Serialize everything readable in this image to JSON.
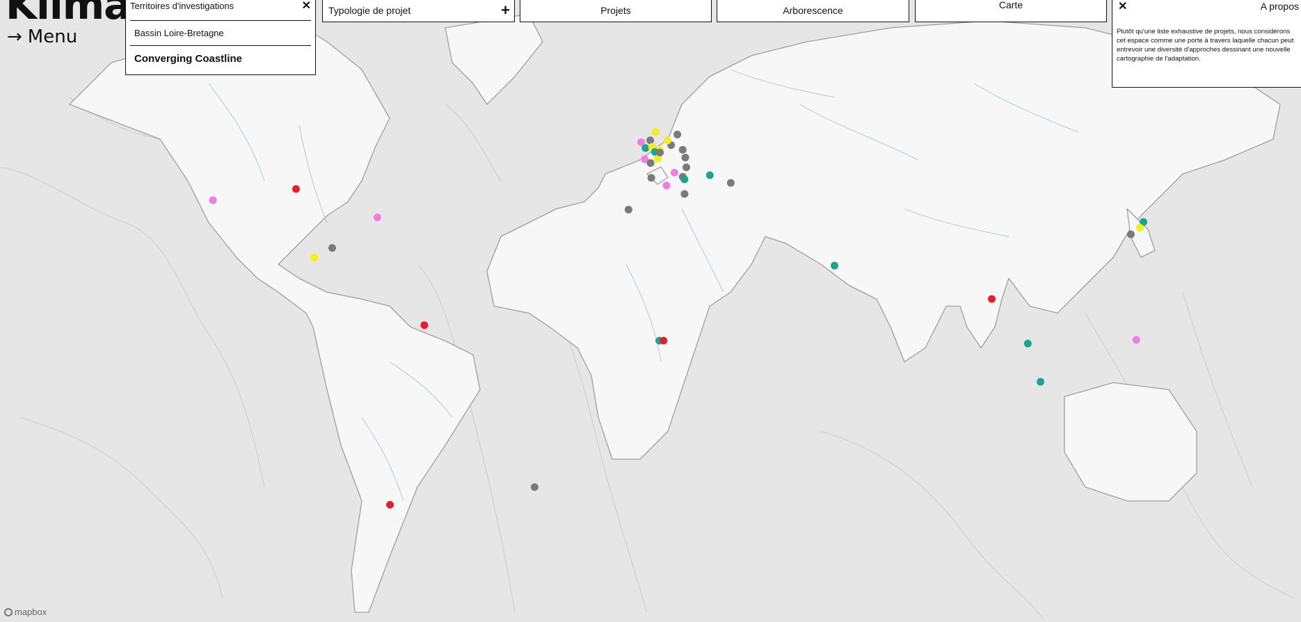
{
  "brand": "Klima",
  "menu": {
    "arrow": "→",
    "label": "Menu"
  },
  "territories": {
    "title": "Territoires d'investigations",
    "close": "✕",
    "items": [
      "Bassin Loire-Bretagne",
      "Converging Coastline"
    ]
  },
  "tabs": {
    "typologie": "Typologie de projet",
    "plus": "+",
    "projets": "Projets",
    "arborescence": "Arborescence",
    "carte": "Carte"
  },
  "apropos": {
    "close": "✕",
    "title": "A propos",
    "text": "Plutôt qu'une liste exhaustive de projets, nous considérons cet espace comme une porte à travers laquelle chacun peut entrevoir une diversité d'approches dessinant une nouvelle cartographie de l'adaptation."
  },
  "attribution": "mapbox",
  "colors": {
    "grey": "#7a7a7a",
    "red": "#e0202a",
    "teal": "#1fa28f",
    "yellow": "#f5ee1b",
    "pink": "#f27ce6",
    "background": "#e9e9e9",
    "land": "#f7f7f7"
  },
  "map_points": [
    {
      "lon": -120.5,
      "lat": 40.5,
      "color": "pink"
    },
    {
      "lon": -97.5,
      "lat": 42.8,
      "color": "red"
    },
    {
      "lon": -75.0,
      "lat": 36.8,
      "color": "pink"
    },
    {
      "lon": -92.5,
      "lat": 27.5,
      "color": "yellow"
    },
    {
      "lon": -87.5,
      "lat": 29.8,
      "color": "grey"
    },
    {
      "lon": -62.0,
      "lat": 10.0,
      "color": "red"
    },
    {
      "lon": -71.5,
      "lat": -36.5,
      "color": "red"
    },
    {
      "lon": -31.5,
      "lat": -32.5,
      "color": "grey"
    },
    {
      "lon": 2.0,
      "lat": 53.2,
      "color": "yellow"
    },
    {
      "lon": -2.0,
      "lat": 51.5,
      "color": "pink"
    },
    {
      "lon": -0.8,
      "lat": 50.5,
      "color": "teal"
    },
    {
      "lon": 0.5,
      "lat": 51.8,
      "color": "grey"
    },
    {
      "lon": 1.0,
      "lat": 50.7,
      "color": "yellow"
    },
    {
      "lon": 3.0,
      "lat": 50.2,
      "color": "yellow"
    },
    {
      "lon": 1.8,
      "lat": 49.8,
      "color": "teal"
    },
    {
      "lon": -1.0,
      "lat": 48.5,
      "color": "pink"
    },
    {
      "lon": 0.6,
      "lat": 47.8,
      "color": "grey"
    },
    {
      "lon": 2.6,
      "lat": 48.6,
      "color": "yellow"
    },
    {
      "lon": 3.2,
      "lat": 49.7,
      "color": "grey"
    },
    {
      "lon": 6.3,
      "lat": 51.0,
      "color": "grey"
    },
    {
      "lon": 5.3,
      "lat": 51.8,
      "color": "yellow"
    },
    {
      "lon": 8.0,
      "lat": 52.8,
      "color": "grey"
    },
    {
      "lon": 9.5,
      "lat": 50.2,
      "color": "grey"
    },
    {
      "lon": 10.2,
      "lat": 48.8,
      "color": "grey"
    },
    {
      "lon": 10.5,
      "lat": 47.0,
      "color": "grey"
    },
    {
      "lon": 9.5,
      "lat": 45.2,
      "color": "grey"
    },
    {
      "lon": 10.0,
      "lat": 44.7,
      "color": "teal"
    },
    {
      "lon": 7.2,
      "lat": 46.0,
      "color": "pink"
    },
    {
      "lon": 5.0,
      "lat": 43.5,
      "color": "pink"
    },
    {
      "lon": 0.8,
      "lat": 45.0,
      "color": "grey"
    },
    {
      "lon": 10.0,
      "lat": 41.8,
      "color": "grey"
    },
    {
      "lon": -5.5,
      "lat": 38.5,
      "color": "grey"
    },
    {
      "lon": 17.0,
      "lat": 45.5,
      "color": "teal"
    },
    {
      "lon": 22.8,
      "lat": 44.0,
      "color": "grey"
    },
    {
      "lon": 51.5,
      "lat": 25.5,
      "color": "teal"
    },
    {
      "lon": 95.0,
      "lat": 17.0,
      "color": "red"
    },
    {
      "lon": 105.0,
      "lat": 5.0,
      "color": "teal"
    },
    {
      "lon": 108.5,
      "lat": -5.5,
      "color": "teal"
    },
    {
      "lon": 3.0,
      "lat": 5.8,
      "color": "teal"
    },
    {
      "lon": 4.2,
      "lat": 5.8,
      "color": "red"
    },
    {
      "lon": 137.0,
      "lat": 35.8,
      "color": "teal"
    },
    {
      "lon": 136.0,
      "lat": 34.5,
      "color": "yellow"
    },
    {
      "lon": 133.5,
      "lat": 33.0,
      "color": "grey"
    },
    {
      "lon": 135.0,
      "lat": 6.0,
      "color": "pink"
    }
  ]
}
